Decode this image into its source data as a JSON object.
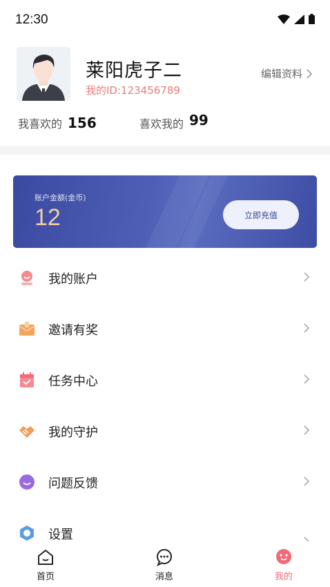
{
  "status_bar": {
    "time": "12:30"
  },
  "profile": {
    "nickname": "莱阳虎子二",
    "user_id": "我的ID:123456789",
    "edit_label": "编辑资料"
  },
  "stats": {
    "likes_label": "我喜欢的",
    "likes_value": "156",
    "liked_by_label": "喜欢我的",
    "liked_by_value": "99"
  },
  "wallet": {
    "label": "账户金额(金币)",
    "amount": "12",
    "recharge_label": "立即充值"
  },
  "menu": {
    "items": [
      {
        "label": "我的账户",
        "icon": "account-icon"
      },
      {
        "label": "邀请有奖",
        "icon": "invite-icon"
      },
      {
        "label": "任务中心",
        "icon": "task-icon"
      },
      {
        "label": "我的守护",
        "icon": "guard-icon"
      },
      {
        "label": "问题反馈",
        "icon": "feedback-icon"
      },
      {
        "label": "设置",
        "icon": "settings-icon"
      }
    ]
  },
  "bottom_nav": {
    "items": [
      {
        "label": "首页",
        "icon": "home-icon"
      },
      {
        "label": "消息",
        "icon": "message-icon"
      },
      {
        "label": "我的",
        "icon": "profile-icon",
        "active": true
      }
    ]
  },
  "colors": {
    "accent": "#f06a78",
    "id_text": "#f07a7a",
    "wallet_gradient_start": "#3b4aa0",
    "wallet_amount": "#f2cfa0"
  }
}
